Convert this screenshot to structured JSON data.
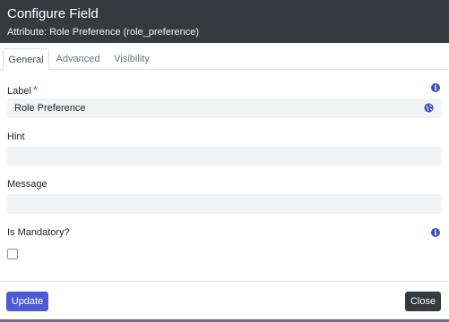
{
  "dialog": {
    "title": "Configure Field",
    "subtitle": "Attribute: Role Preference (role_preference)"
  },
  "tabs": [
    {
      "label": "General",
      "active": true
    },
    {
      "label": "Advanced",
      "active": false
    },
    {
      "label": "Visibility",
      "active": false
    }
  ],
  "fields": {
    "label": {
      "label": "Label",
      "required_mark": "*",
      "value": "Role Preference"
    },
    "hint": {
      "label": "Hint",
      "value": ""
    },
    "message": {
      "label": "Message",
      "value": ""
    },
    "mandatory": {
      "label": "Is Mandatory?",
      "checked": false
    }
  },
  "icons": {
    "info": "info-icon",
    "globe": "globe-icon"
  },
  "buttons": {
    "update": "Update",
    "close": "Close"
  },
  "colors": {
    "header_bg": "#343a40",
    "primary": "#4c5bd4",
    "info": "#3f51b5",
    "required": "#dc3545"
  }
}
